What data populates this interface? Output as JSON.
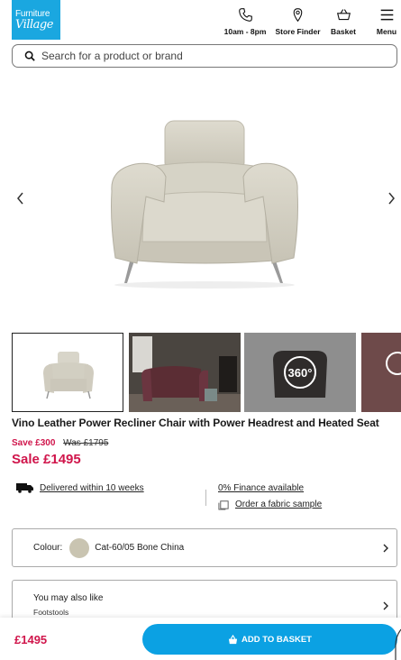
{
  "header": {
    "logo_line1": "Furniture",
    "logo_line2": "Village",
    "nav": [
      {
        "label": "10am - 8pm",
        "icon": "phone-icon"
      },
      {
        "label": "Store Finder",
        "icon": "location-pin-icon"
      },
      {
        "label": "Basket",
        "icon": "basket-icon"
      },
      {
        "label": "Menu",
        "icon": "hamburger-menu-icon"
      }
    ]
  },
  "search": {
    "placeholder": "Search for a product or brand"
  },
  "gallery": {
    "thumbnails": [
      "chair-front",
      "lifestyle-room",
      "360-view",
      "feature-close-up"
    ],
    "badge_360": "360°"
  },
  "product": {
    "title": "Vino Leather Power Recliner Chair with Power Headrest and Heated Seat",
    "save_text": "Save £300",
    "was_text": "Was £1795",
    "sale_text": "Sale £1495"
  },
  "info": {
    "delivery": "Delivered within 10 weeks",
    "finance": "0% Finance available",
    "sample": "Order a fabric sample"
  },
  "colour": {
    "label": "Colour:",
    "value": "Cat-60/05 Bone China",
    "swatch": "#c9c4b1"
  },
  "also_like": {
    "title": "You may also like",
    "subtitle": "Footstools"
  },
  "footer": {
    "price": "£1495",
    "button": "ADD TO BASKET"
  },
  "colors": {
    "brand": "#1aa7e0",
    "sale": "#d0154b",
    "button": "#0ba1e3"
  }
}
